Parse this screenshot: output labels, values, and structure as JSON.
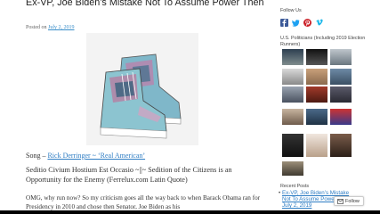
{
  "post": {
    "title": "Ex-VP, Joe Biden’s Mistake Not To Assume Power Then",
    "posted_on": "Posted on",
    "date": "July 2, 2019",
    "song_prefix": "Song – ",
    "song_link": "Rick Derringer ~ ‘Real American’",
    "quote": "Seditio Civium Hostium Est Occasio ~||~ Sedition of the Citizens is an Opportunity for the Enemy  (Ferrelux.com Latin Quote)",
    "body": "OMG, why run now? So my criticism goes all the way back to when Barack Obama ran for Presidency in 2010 and chose then Senator, Joe Biden as his"
  },
  "sidebar": {
    "follow_us": "Follow Us",
    "social_icons": [
      "facebook-icon",
      "twitter-icon",
      "pinterest-icon",
      "vimeo-icon"
    ],
    "politicians_heading": "U.S. Politicians (Including 2019 Election Runners)",
    "recent_heading": "Recent Posts",
    "recent_link": "Ex-VP, Joe Biden’s Mistake Not To Assume Power Then July 2, 2019",
    "follow_button": "Follow"
  },
  "colors": {
    "link": "#2e7dc4",
    "facebook": "#3b5998",
    "twitter": "#1da1f2",
    "pinterest": "#cb2027",
    "vimeo": "#1ab7ea"
  }
}
